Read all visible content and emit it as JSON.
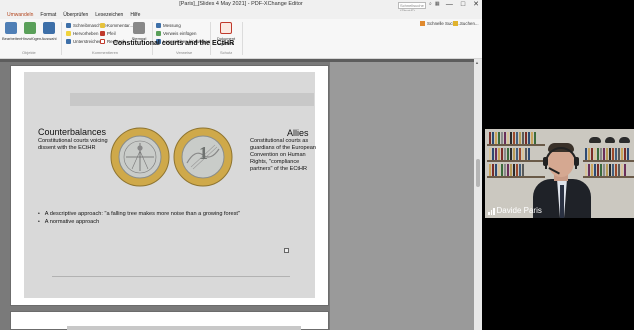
{
  "window": {
    "title": "[Paris]_[Slides 4 May 2021] - PDF-XChange Editor",
    "search_placeholder": "Schnellsuche (Strg+F)...",
    "controls": [
      "—",
      "□",
      "✕"
    ]
  },
  "menu": [
    "Umwandeln",
    "Format",
    "Überprüfen",
    "Lesezeichen",
    "Hilfe"
  ],
  "ribbon": {
    "big_buttons": [
      "Bearbeiten",
      "Hinzufügen",
      "Auswahl"
    ],
    "group1_items": [
      "Schreibmaschine",
      "Kommentar...",
      "Hervorheben",
      "Pfeil",
      "Unterstreichen",
      "Rechteck..."
    ],
    "stamp_label": "Stempel",
    "group2_items": [
      "Messung",
      "Verweis einfügen",
      "Lesezeichen hinzufügen"
    ],
    "signature_label": "Dokument signieren",
    "groups": [
      "Objekte",
      "Kommentieren",
      "Verweise",
      "Schutz"
    ],
    "right_tools": [
      "Schnelle Suche...",
      "Suchen..."
    ]
  },
  "slide": {
    "title": "Constitutional courts and the ECtHR",
    "left_heading": "Counterbalances",
    "left_text": "Constitutional courts voicing dissent with the ECtHR",
    "right_heading": "Allies",
    "right_text": "Constitutional courts as guardians of the European Convention on Human Rights, \"compliance partners\" of the ECtHR",
    "bullets": [
      "A descriptive approach: \"a falling tree makes more noise than a growing forest\"",
      "A normative approach"
    ],
    "coin_value": "1"
  },
  "video": {
    "participant_name": "Davide Paris"
  },
  "colors": {
    "accent": "#b3461e",
    "doc_background": "#7a7a7a",
    "slide_band": "#c8c8c8"
  }
}
